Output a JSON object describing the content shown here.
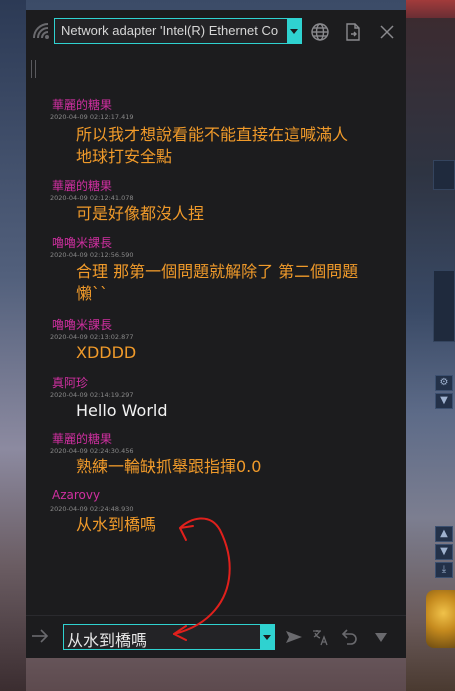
{
  "topbar": {
    "adapter_value": "Network adapter 'Intel(R) Ethernet Co"
  },
  "messages": [
    {
      "sender": "華麗的糖果",
      "timestamp": "2020-04-09 02:12:17.419",
      "lines": [
        "所以我才想說看能不能直接在這喊滿人",
        "地球打安全點"
      ],
      "color": "orange"
    },
    {
      "sender": "華麗的糖果",
      "timestamp": "2020-04-09 02:12:41.078",
      "lines": [
        "可是好像都沒人捏"
      ],
      "color": "orange"
    },
    {
      "sender": "嚕嚕米課長",
      "timestamp": "2020-04-09 02:12:56.590",
      "lines": [
        "合理 那第一個問題就解除了 第二個問題",
        "懶``"
      ],
      "color": "orange"
    },
    {
      "sender": "嚕嚕米課長",
      "timestamp": "2020-04-09 02:13:02.877",
      "lines": [
        "XDDDD"
      ],
      "color": "orange"
    },
    {
      "sender": "真阿珍",
      "timestamp": "2020-04-09 02:14:19.297",
      "lines": [
        "Hello World"
      ],
      "color": "white"
    },
    {
      "sender": "華麗的糖果",
      "timestamp": "2020-04-09 02:24:30.456",
      "lines": [
        "熟練一輪缺抓舉跟指揮0.0"
      ],
      "color": "orange"
    },
    {
      "sender": "Azarovy",
      "timestamp": "2020-04-09 02:24:48.930",
      "lines": [
        "从水到橋嗎"
      ],
      "color": "orange"
    }
  ],
  "input": {
    "value": "从水到橋嗎"
  },
  "colors": {
    "accent": "#2fd2d0",
    "sender": "#cf2fa0",
    "message": "#f09a2a",
    "annotation": "#e0201c"
  },
  "icons": [
    "wifi-icon",
    "globe-icon",
    "export-icon",
    "close-icon",
    "send-icon",
    "translate-icon",
    "undo-icon",
    "dropdown-icon"
  ]
}
